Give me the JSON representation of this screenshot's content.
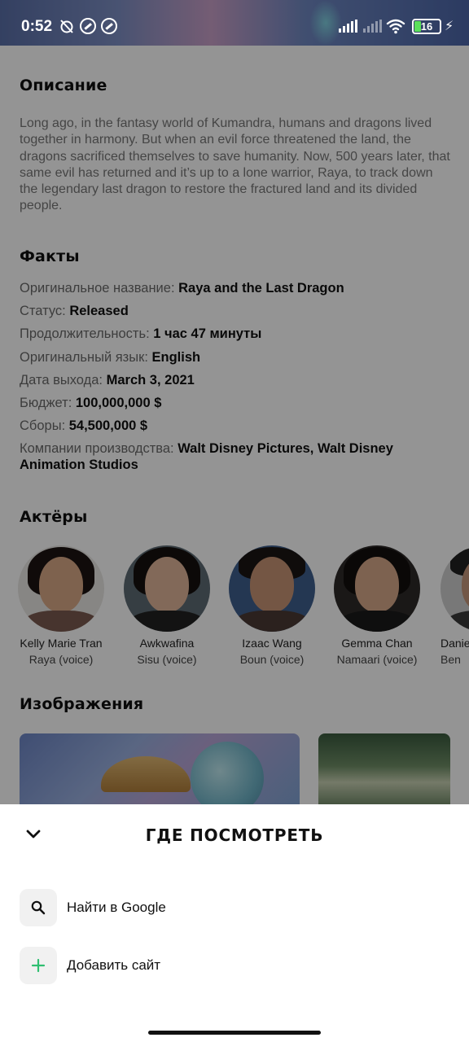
{
  "status_bar": {
    "time": "0:52",
    "battery_level": "16"
  },
  "sections": {
    "description_title": "Описание",
    "facts_title": "Факты",
    "cast_title": "Актёры",
    "images_title": "Изображения"
  },
  "description": "Long ago, in the fantasy world of Kumandra, humans and dragons lived together in harmony. But when an evil force threatened the land, the dragons sacrificed themselves to save humanity. Now, 500 years later, that same evil has returned and it’s up to a lone warrior, Raya, to track down the legendary last dragon to restore the fractured land and its divided people.",
  "facts": [
    {
      "label": "Оригинальное название: ",
      "value": "Raya and the Last Dragon"
    },
    {
      "label": "Статус: ",
      "value": "Released"
    },
    {
      "label": "Продолжительность: ",
      "value": "1 час 47 минуты"
    },
    {
      "label": "Оригинальный язык: ",
      "value": "English"
    },
    {
      "label": "Дата выхода: ",
      "value": "March 3, 2021"
    },
    {
      "label": "Бюджет: ",
      "value": "100,000,000 $"
    },
    {
      "label": "Сборы: ",
      "value": "54,500,000 $"
    },
    {
      "label": "Компании производства: ",
      "value": "Walt Disney Pictures, Walt Disney Animation Studios"
    }
  ],
  "cast": [
    {
      "name": "Kelly Marie Tran",
      "role": "Raya (voice)"
    },
    {
      "name": "Awkwafina",
      "role": "Sisu (voice)"
    },
    {
      "name": "Izaac Wang",
      "role": "Boun (voice)"
    },
    {
      "name": "Gemma Chan",
      "role": "Namaari (voice)"
    },
    {
      "name": "Danie",
      "role": "Ben"
    }
  ],
  "sheet": {
    "title": "ГДЕ ПОСМОТРЕТЬ",
    "actions": [
      {
        "label": "Найти в Google",
        "icon": "search-icon"
      },
      {
        "label": "Добавить сайт",
        "icon": "plus-icon"
      }
    ]
  },
  "colors": {
    "accent_green": "#2fbf71",
    "overlay": "rgba(0,0,0,0.42)"
  }
}
